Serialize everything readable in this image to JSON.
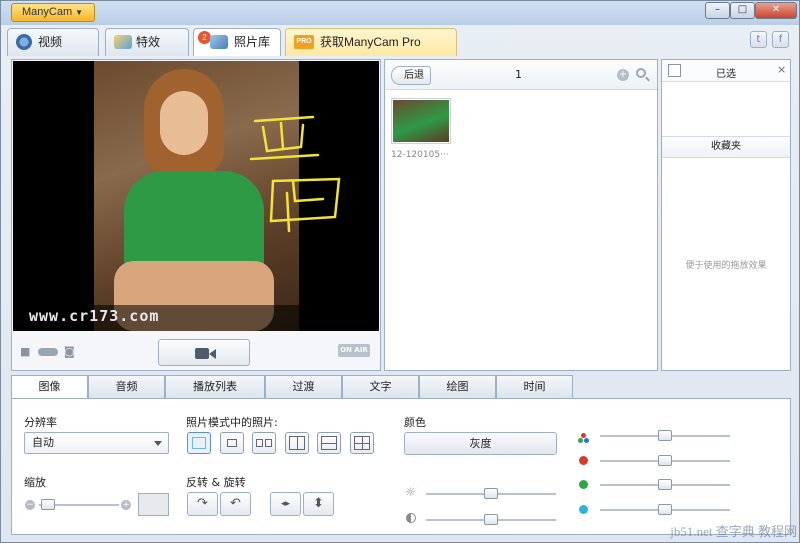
{
  "app": {
    "brand_label": "ManyCam",
    "min": "–",
    "max": "□",
    "close": "✕"
  },
  "tabs": [
    {
      "label": "视频",
      "icon": "video-icon"
    },
    {
      "label": "特效",
      "icon": "effects-icon"
    },
    {
      "label": "照片库",
      "icon": "photo-gallery-icon",
      "badge": "2"
    },
    {
      "label": "获取ManyCam Pro",
      "icon": "pro-icon",
      "tag": "PRO"
    }
  ],
  "social": {
    "twitter": "t",
    "facebook": "f"
  },
  "preview": {
    "watermark": "www.cr173.com",
    "onair": "ON AIR"
  },
  "gallery": {
    "back": "后退",
    "page": "1",
    "add": "+",
    "thumb_label": "12-120105···"
  },
  "sidebar": {
    "selected_title": "已选",
    "close": "×",
    "favorites_title": "收藏夹",
    "hint": "便于使用的拖放效果"
  },
  "bottom_tabs": [
    "图像",
    "音频",
    "播放列表",
    "过渡",
    "文字",
    "绘图",
    "时间"
  ],
  "image_panel": {
    "resolution_label": "分辨率",
    "resolution_value": "自动",
    "photo_mode_label": "照片模式中的照片:",
    "color_label": "颜色",
    "gray_button": "灰度",
    "zoom_label": "缩放",
    "zoom_minus": "−",
    "zoom_plus": "+",
    "flip_label": "反转 & 旋转",
    "rotate_right": "↷",
    "rotate_left": "↶",
    "flip_h": "◂▸",
    "flip_v": "⬍"
  },
  "colors": {
    "accent": "#f5b62a",
    "red": "#d93a2a",
    "green": "#2ea64a",
    "cyan": "#2eb3d6"
  },
  "site_watermark": "jb51.net 查字典 教程网"
}
